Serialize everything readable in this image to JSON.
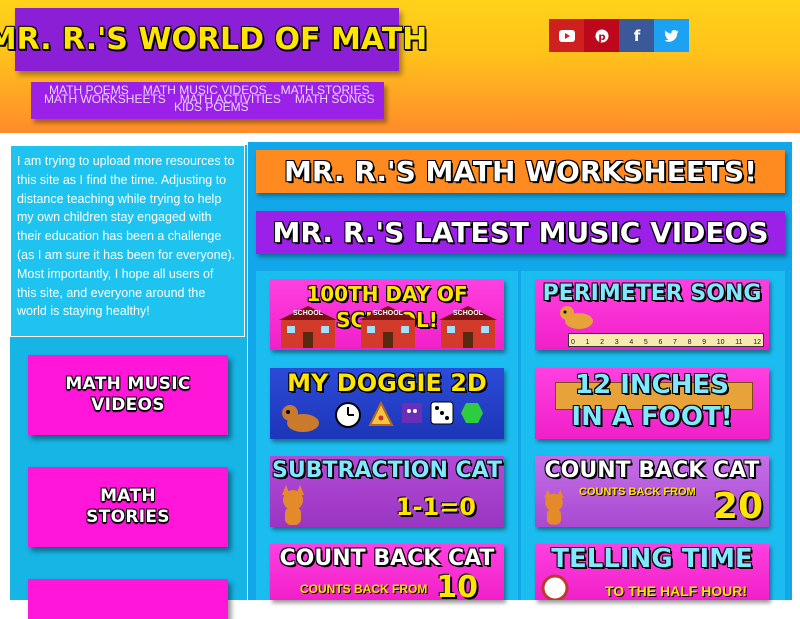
{
  "header": {
    "logo_text": "MR. R.'S WORLD OF MATH",
    "social": [
      {
        "icon": "youtube-icon",
        "glyph": "▶",
        "color": "#cd201f"
      },
      {
        "icon": "pinterest-icon",
        "glyph": "℗",
        "color": "#bd081c"
      },
      {
        "icon": "facebook-icon",
        "glyph": "f",
        "color": "#3b5998"
      },
      {
        "icon": "twitter-icon",
        "glyph": "🐦",
        "color": "#1da1f2"
      }
    ],
    "nav": {
      "row1": [
        "MATH POEMS",
        "MATH MUSIC VIDEOS",
        "MATH STORIES"
      ],
      "row2": [
        "MATH WORKSHEETS",
        "MATH ACTIVITIES",
        "MATH SONGS"
      ],
      "row3": [
        "KIDS POEMS"
      ]
    }
  },
  "sidebar": {
    "intro": "I am trying to upload more resources to this site as I find the time. Adjusting to distance teaching while trying to help my own children stay engaged with their education has been a challenge (as I am sure it has been for everyone). Most importantly, I hope all users of this site, and everyone around the world is staying healthy!",
    "buttons": [
      "MATH MUSIC\nVIDEOS",
      "MATH\nSTORIES"
    ]
  },
  "main": {
    "banner_worksheets": "MR. R.'S MATH WORKSHEETS!",
    "banner_videos": "MR. R.'S LATEST MUSIC VIDEOS",
    "videos_left": [
      {
        "title": "100TH DAY OF SCHOOL!",
        "school_label": "SCHOOL"
      },
      {
        "title": "MY DOGGIE 2D"
      },
      {
        "title": "SUBTRACTION CAT",
        "number": "1-1=0"
      },
      {
        "title": "COUNT BACK CAT",
        "sub": "COUNTS BACK FROM",
        "number": "10"
      }
    ],
    "videos_right": [
      {
        "title": "PERIMETER SONG",
        "ruler": [
          "0",
          "1",
          "2",
          "3",
          "4",
          "5",
          "6",
          "7",
          "8",
          "9",
          "10",
          "11",
          "12"
        ]
      },
      {
        "title": "12 INCHES\nIN A FOOT!"
      },
      {
        "title": "COUNT BACK CAT",
        "sub": "COUNTS BACK FROM",
        "number": "20"
      },
      {
        "title": "TELLING TIME",
        "sub": "TO THE HALF HOUR!"
      }
    ]
  },
  "colors": {
    "logo_bg": "#8a1fd6",
    "logo_text": "#ffe500",
    "nav_bg": "#9b20e8",
    "sidebar_button": "#ff16d9",
    "banner_orange": "#ff8a1f",
    "banner_purple": "#9b20e8"
  }
}
